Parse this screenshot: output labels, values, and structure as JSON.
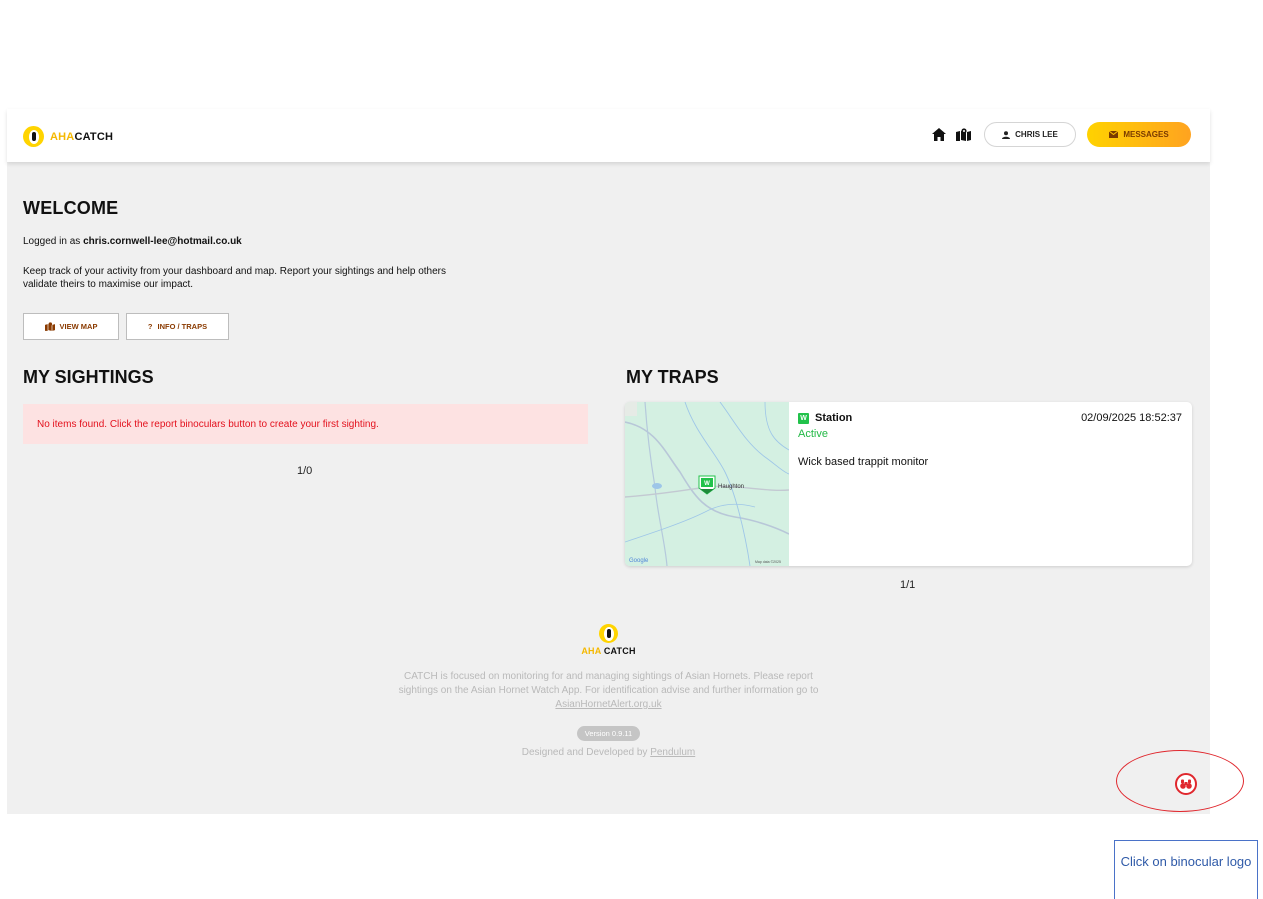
{
  "brand": {
    "aha": "AHA",
    "catch": "CATCH"
  },
  "header": {
    "user_label": "CHRIS LEE",
    "messages_label": "MESSAGES"
  },
  "welcome": {
    "title": "WELCOME",
    "logged_prefix": "Logged in as ",
    "email": "chris.cornwell-lee@hotmail.co.uk",
    "intro": "Keep track of your activity from your dashboard and map. Report your sightings and help others validate theirs to maximise our impact.",
    "view_map_label": "VIEW MAP",
    "info_traps_label": "INFO / TRAPS"
  },
  "sightings": {
    "title": "MY SIGHTINGS",
    "empty_message": "No items found. Click the report binoculars button to create your first sighting.",
    "pager": "1/0"
  },
  "traps": {
    "title": "MY TRAPS",
    "items": [
      {
        "badge": "W",
        "name": "Station",
        "datetime": "02/09/2025 18:52:37",
        "status": "Active",
        "description": "Wick based trappit monitor",
        "map_place": "Haughton",
        "map_credit": "Map data ©2025",
        "map_provider": "Google"
      }
    ],
    "pager": "1/1"
  },
  "footer": {
    "text_before_link": "CATCH is focused on monitoring for and managing sightings of Asian Hornets. Please report sightings on the Asian Hornet Watch App. For identification advise and further information go to ",
    "link": "AsianHornetAlert.org.uk",
    "version": "Version 0.9.11",
    "designed_prefix": "Designed and Developed by ",
    "designed_link": "Pendulum"
  },
  "annotation": {
    "callout": "Click on binocular logo"
  },
  "colors": {
    "accent_yellow": "#ffd400",
    "messages_gradient_end": "#ffa320",
    "alert_text": "#e3111d",
    "active_green": "#22b845",
    "annotation_red": "#e0282e",
    "callout_blue": "#2f5aa8"
  }
}
